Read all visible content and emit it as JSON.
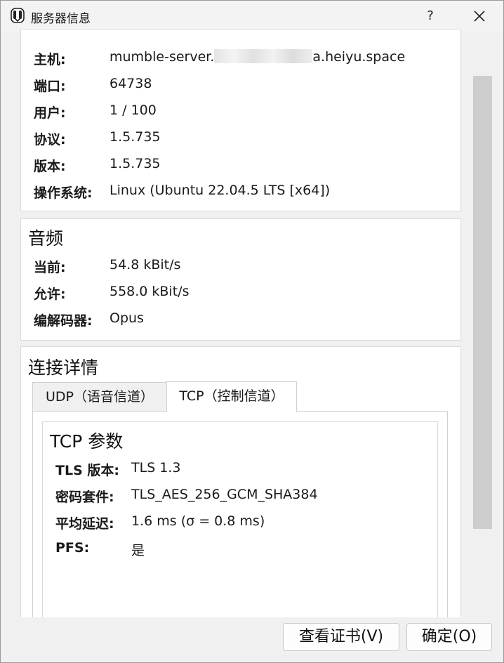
{
  "window": {
    "title": "服务器信息",
    "help_label": "?"
  },
  "server": {
    "rows": [
      {
        "label": "主机:",
        "value_prefix": "mumble-server.",
        "value_suffix": "a.heiyu.space"
      },
      {
        "label": "端口:",
        "value": "64738"
      },
      {
        "label": "用户:",
        "value": "1 / 100"
      },
      {
        "label": "协议:",
        "value": "1.5.735"
      },
      {
        "label": "版本:",
        "value": "1.5.735"
      },
      {
        "label": "操作系统:",
        "value": "Linux (Ubuntu 22.04.5 LTS [x64])"
      }
    ]
  },
  "audio": {
    "title": "音频",
    "rows": [
      {
        "label": "当前:",
        "value": "54.8 kBit/s"
      },
      {
        "label": "允许:",
        "value": "558.0 kBit/s"
      },
      {
        "label": "编解码器:",
        "value": "Opus"
      }
    ]
  },
  "connection": {
    "title": "连接详情",
    "tabs": [
      {
        "label": "UDP（语音信道）",
        "active": false
      },
      {
        "label": "TCP（控制信道）",
        "active": true
      }
    ],
    "tcp": {
      "title": "TCP 参数",
      "rows": [
        {
          "label": "TLS 版本:",
          "value": "TLS 1.3"
        },
        {
          "label": "密码套件:",
          "value": "TLS_AES_256_GCM_SHA384"
        },
        {
          "label": "平均延迟:",
          "value": "1.6 ms (σ = 0.8 ms)"
        },
        {
          "label": "PFS:",
          "value": "是"
        }
      ]
    }
  },
  "footer": {
    "view_cert_label": "查看证书(V)",
    "ok_label": "确定(O)"
  },
  "colors": {
    "window_bg": "#f0f0f0",
    "panel_bg": "#ffffff",
    "scrollbar_thumb": "#cdcdcd"
  }
}
